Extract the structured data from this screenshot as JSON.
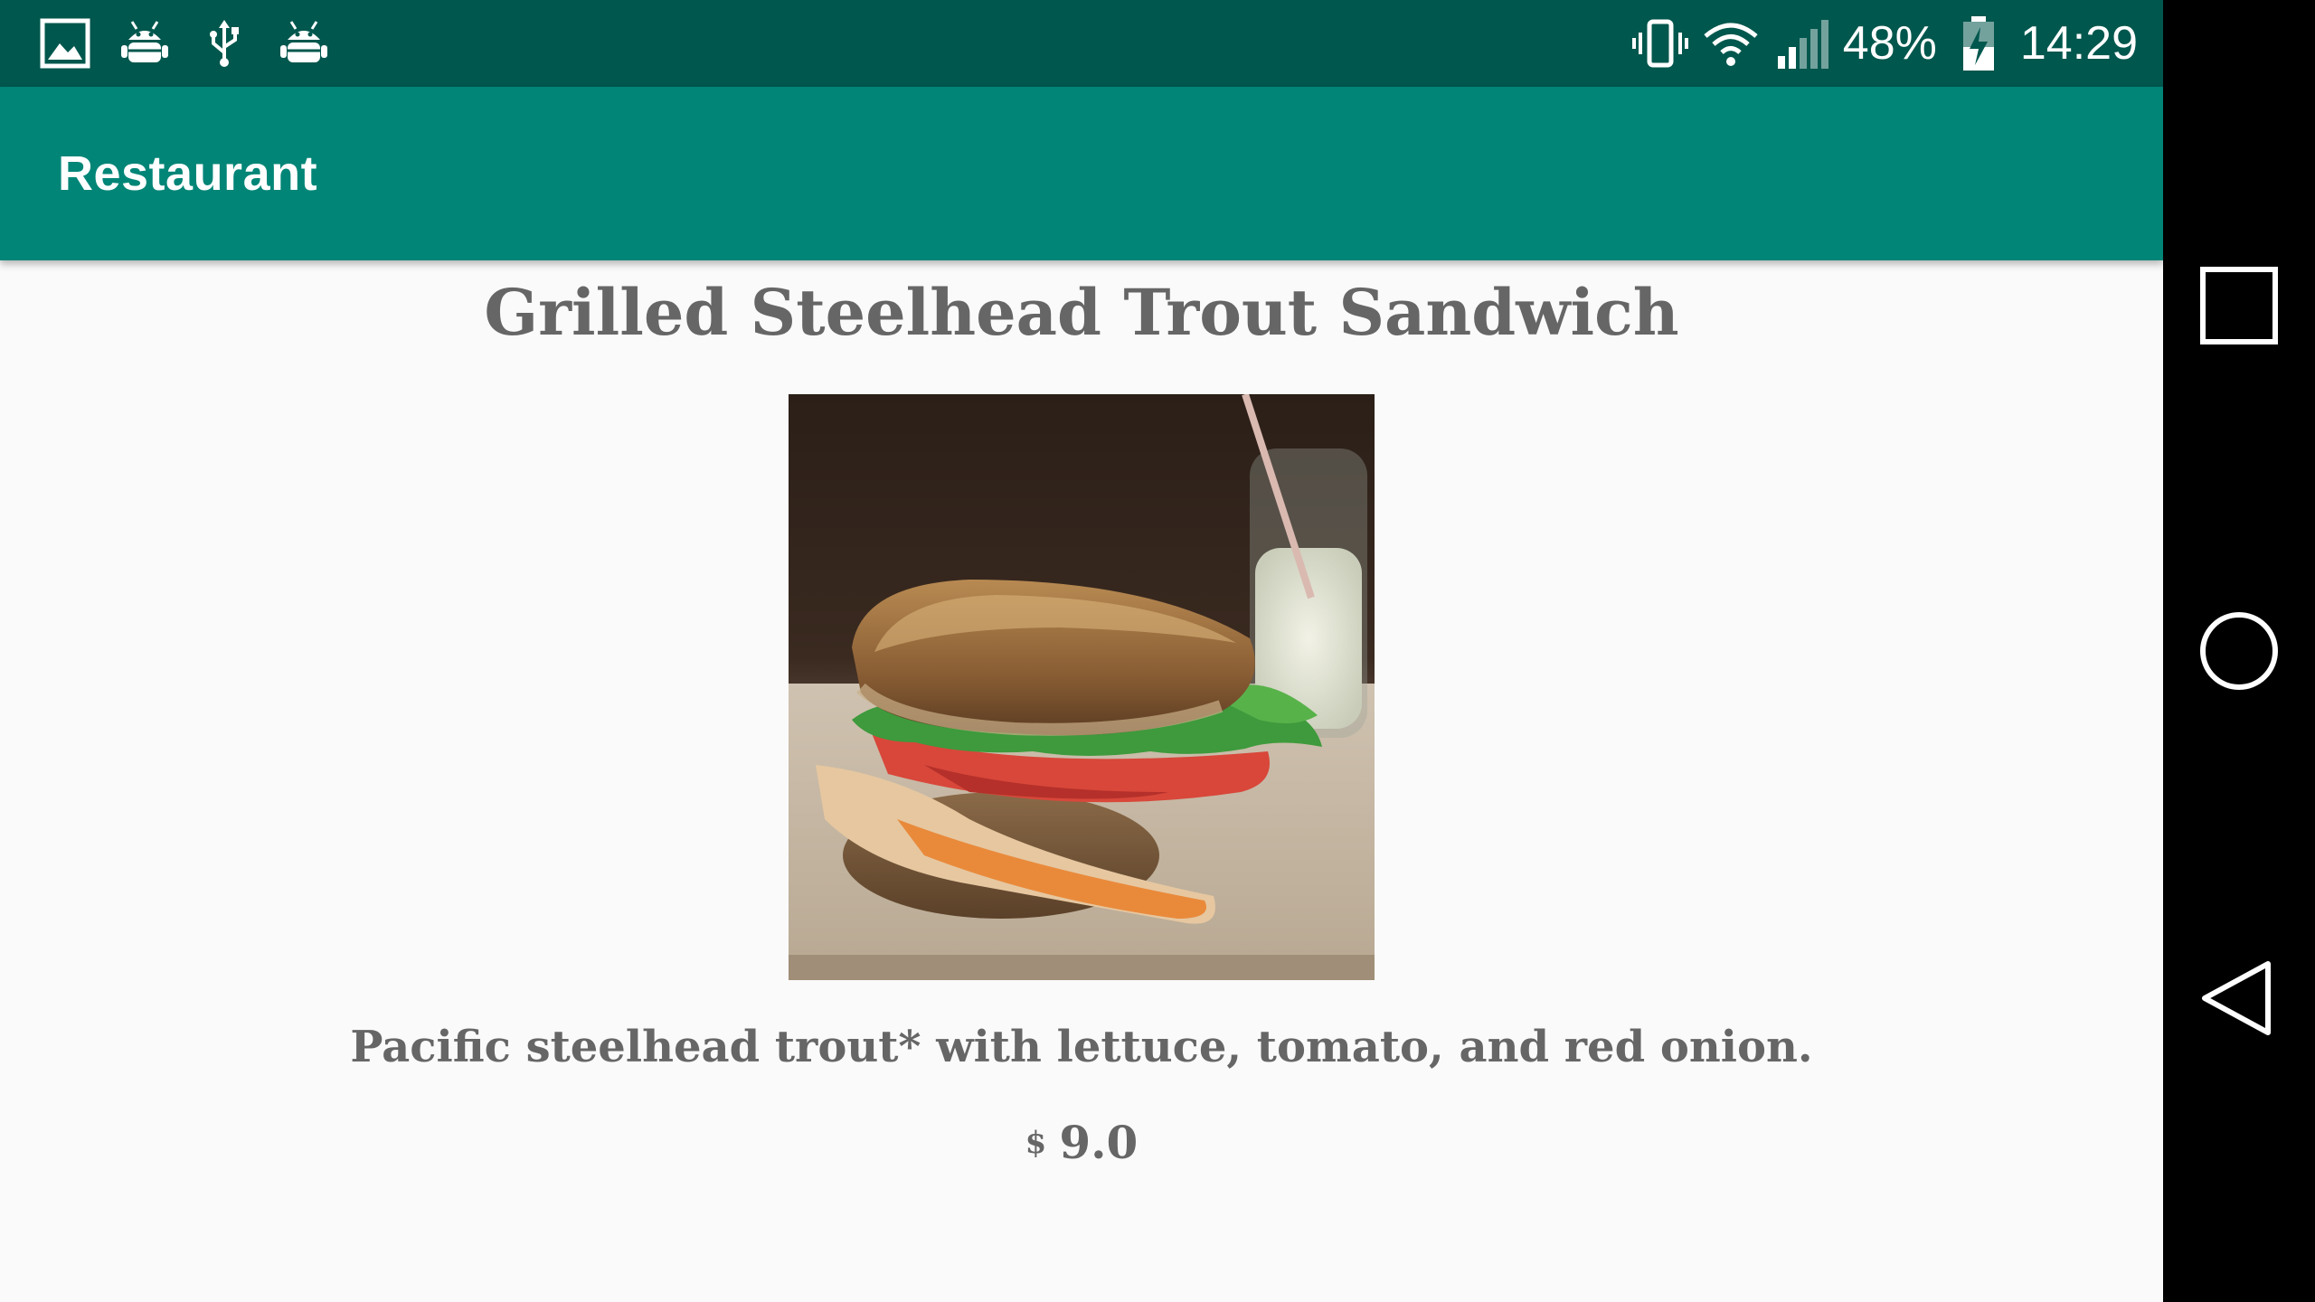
{
  "status_bar": {
    "left_icons": [
      "gallery-icon",
      "android-debug-icon",
      "usb-icon",
      "android-debug-icon"
    ],
    "battery_percent": "48%",
    "time": "14:29"
  },
  "toolbar": {
    "title": "Restaurant"
  },
  "dish": {
    "name": "Grilled Steelhead Trout Sandwich",
    "description": "Pacific steelhead trout* with lettuce, tomato, and red onion.",
    "currency": "$",
    "price": "9.0"
  },
  "nav_bar": {
    "buttons": [
      "recents-icon",
      "home-icon",
      "back-icon"
    ]
  },
  "colors": {
    "status_bar": "#00574D",
    "toolbar": "#008577",
    "background": "#FAFAFA",
    "text": "#666666"
  }
}
